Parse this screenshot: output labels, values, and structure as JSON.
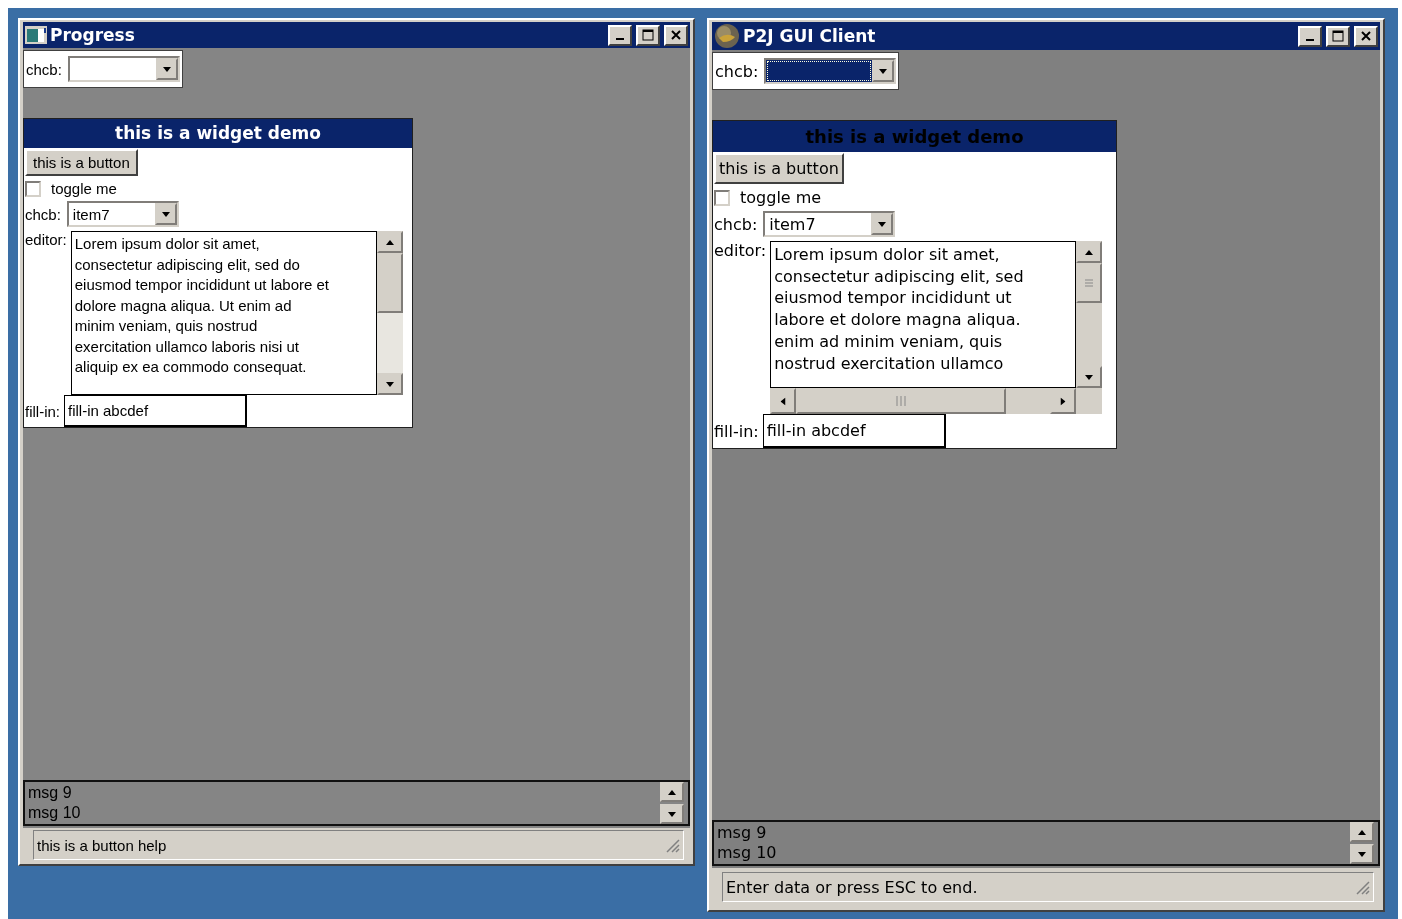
{
  "windows": [
    {
      "title": "Progress",
      "top_combo": {
        "label": "chcb:",
        "focused": false
      },
      "demo": {
        "title": "this is a widget demo",
        "button": "this is a button",
        "checkbox": {
          "label": "toggle me",
          "checked": false
        },
        "combo": {
          "label": "chcb:",
          "value": "item7"
        },
        "editor": {
          "label": "editor:",
          "horizontal_scrollbar": false,
          "lines": [
            "Lorem ipsum dolor sit amet,",
            "consectetur adipiscing elit, sed do",
            "eiusmod tempor incididunt ut labore et",
            "dolore magna aliqua. Ut enim ad",
            "minim veniam, quis nostrud",
            "exercitation ullamco laboris nisi ut",
            "aliquip ex ea commodo consequat."
          ]
        },
        "fill_in": {
          "label": "fill-in:",
          "value": "fill-in abcdef"
        }
      },
      "messages": [
        "msg 9",
        "msg 10"
      ],
      "status_bar": "this is a button help"
    },
    {
      "title": "P2J GUI Client",
      "top_combo": {
        "label": "chcb:",
        "focused": true
      },
      "demo": {
        "title": "this is a widget demo",
        "button": "this is a button",
        "checkbox": {
          "label": "toggle me",
          "checked": false
        },
        "combo": {
          "label": "chcb:",
          "value": "item7"
        },
        "editor": {
          "label": "editor:",
          "horizontal_scrollbar": true,
          "lines": [
            "Lorem ipsum dolor sit amet,",
            "consectetur adipiscing elit, sed",
            "eiusmod tempor incididunt ut",
            "labore et dolore magna aliqua.",
            "enim ad minim veniam, quis",
            "nostrud exercitation ullamco"
          ]
        },
        "fill_in": {
          "label": "fill-in:",
          "value": "fill-in abcdef"
        }
      },
      "messages": [
        "msg 9",
        "msg 10"
      ],
      "status_bar": "Enter data or press ESC to end."
    }
  ]
}
